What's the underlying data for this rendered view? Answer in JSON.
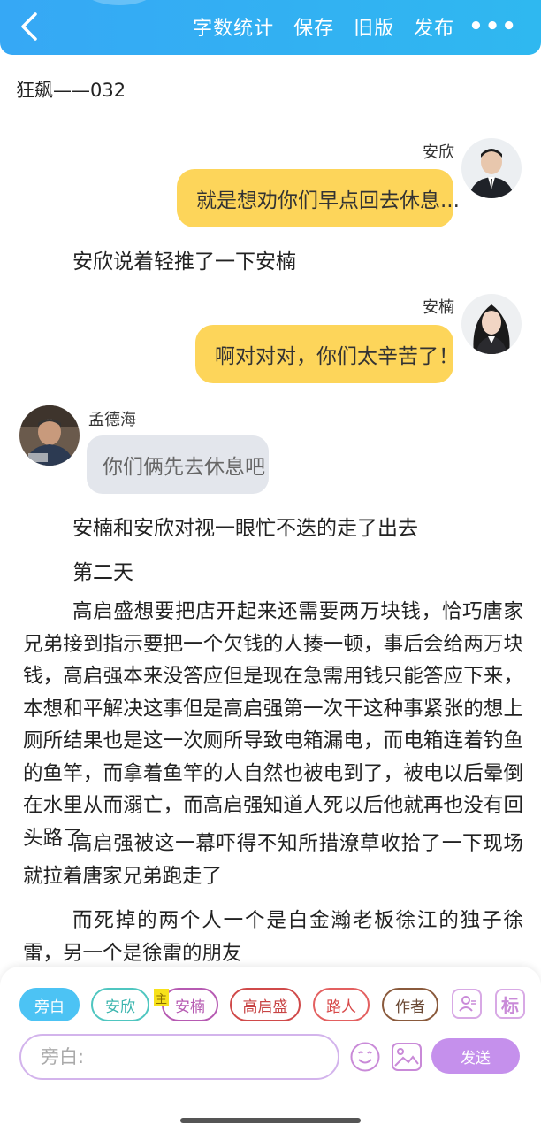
{
  "header": {
    "actions": [
      "字数统计",
      "保存",
      "旧版",
      "发布"
    ],
    "more": "•••"
  },
  "doc_title": "狂飙——032",
  "messages": [
    {
      "speaker": "安欣",
      "text": "就是想劝你们早点回去休息..."
    },
    {
      "narration": "安欣说着轻推了一下安楠"
    },
    {
      "speaker": "安楠",
      "text": "啊对对对，你们太辛苦了！"
    },
    {
      "speaker": "孟德海",
      "text": "你们俩先去休息吧"
    },
    {
      "narration": "安楠和安欣对视一眼忙不迭的走了出去"
    },
    {
      "narration": "第二天"
    }
  ],
  "paragraphs": [
    "高启盛想要把店开起来还需要两万块钱，恰巧唐家兄弟接到指示要把一个欠钱的人揍一顿，事后会给两万块钱，高启强本来没答应但是现在急需用钱只能答应下来，本想和平解决这事但是高启强第一次干这种事紧张的想上厕所结果也是这一次厕所导致电箱漏电，而电箱连着钓鱼的鱼竿，而拿着鱼竿的人自然也被电到了，被电以后晕倒在水里从而溺亡，而高启强知道人死以后他就再也没有回头路了",
    "高启强被这一幕吓得不知所措潦草收拾了一下现场就拉着唐家兄弟跑走了",
    "而死掉的两个人一个是白金瀚老板徐江的独子徐雷，另一个是徐雷的朋友"
  ],
  "roles": [
    "旁白",
    "安欣",
    "安楠",
    "高启盛",
    "路人",
    "作者"
  ],
  "main_tag": "主",
  "tool_icons": {
    "profile": "person-card-icon",
    "mark_label": "标"
  },
  "input": {
    "placeholder": "旁白:"
  },
  "send_label": "发送",
  "colors": {
    "header": "#36a8f5",
    "bubble_right": "#fdd55a",
    "bubble_left": "#e3e6ec",
    "active_chip": "#4cc3f4",
    "send": "#c590ec"
  }
}
